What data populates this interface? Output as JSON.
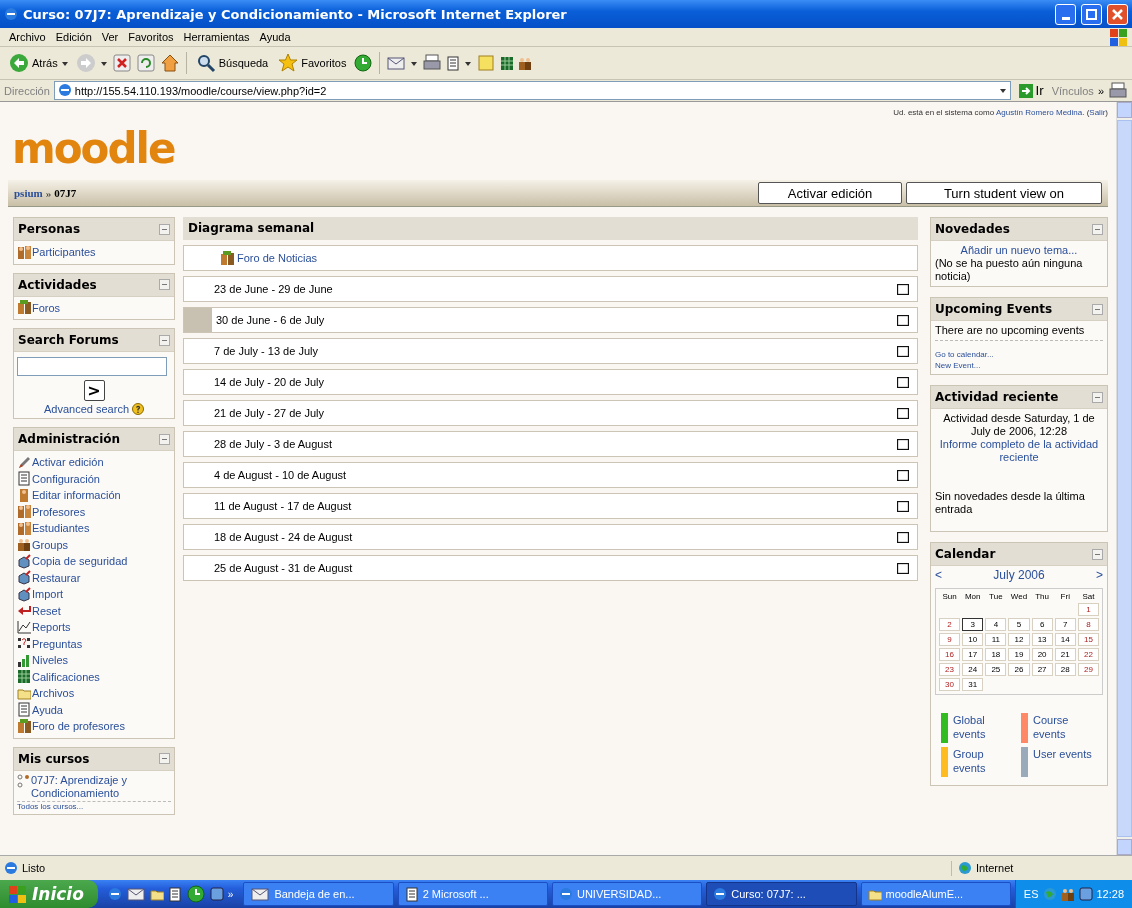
{
  "window": {
    "title": "Curso: 07J7: Aprendizaje y Condicionamiento - Microsoft Internet Explorer"
  },
  "menu": [
    "Archivo",
    "Edición",
    "Ver",
    "Favoritos",
    "Herramientas",
    "Ayuda"
  ],
  "toolbar": {
    "back": "Atrás",
    "search": "Búsqueda",
    "favorites": "Favoritos"
  },
  "address": {
    "label": "Dirección",
    "url": "http://155.54.110.193/moodle/course/view.php?id=2",
    "go": "Ir",
    "links": "Vínculos",
    "more": "»"
  },
  "page": {
    "logo": "moodle",
    "login": {
      "prefix": "Ud. está en el sistema como ",
      "user": "Agustín Romero Medina",
      "middle": ". (",
      "logout": "Salir",
      "suffix": ")"
    },
    "breadcrumb": {
      "parent": "psium",
      "separator": "»",
      "current": "07J7"
    },
    "buttons": [
      "Activar edición",
      "Turn student view on"
    ],
    "left_blocks": [
      {
        "kind": "links",
        "title": "Personas",
        "items": [
          "Participantes"
        ]
      },
      {
        "kind": "links",
        "title": "Actividades",
        "items": [
          "Foros"
        ]
      },
      {
        "kind": "search",
        "title": "Search Forums",
        "button": ">",
        "link": "Advanced search"
      },
      {
        "kind": "links",
        "title": "Administración",
        "items": [
          "Activar edición",
          "Configuración",
          "Editar información",
          "Profesores",
          "Estudiantes",
          "Groups",
          "Copia de seguridad",
          "Restaurar",
          "Import",
          "Reset",
          "Reports",
          "Preguntas",
          "Niveles",
          "Calificaciones",
          "Archivos",
          "Ayuda",
          "Foro de profesores"
        ]
      },
      {
        "kind": "courses",
        "title": "Mis cursos",
        "items": [
          "07J7: Aprendizaje y Condicionamiento"
        ],
        "footer": "Todos los cursos..."
      }
    ],
    "center": {
      "title": "Diagrama semanal",
      "forum": "Foro de Noticias",
      "weeks": [
        {
          "label": "23 de June - 29 de June",
          "current": false
        },
        {
          "label": "30 de June - 6 de July",
          "current": true
        },
        {
          "label": "7 de July - 13 de July",
          "current": false
        },
        {
          "label": "14 de July - 20 de July",
          "current": false
        },
        {
          "label": "21 de July - 27 de July",
          "current": false
        },
        {
          "label": "28 de July - 3 de August",
          "current": false
        },
        {
          "label": "4 de August - 10 de August",
          "current": false
        },
        {
          "label": "11 de August - 17 de August",
          "current": false
        },
        {
          "label": "18 de August - 24 de August",
          "current": false
        },
        {
          "label": "25 de August - 31 de August",
          "current": false
        }
      ]
    },
    "right_blocks": [
      {
        "kind": "content",
        "title": "Novedades",
        "content": [
          {
            "kind": "center-link",
            "text": "Añadir un nuevo tema..."
          },
          {
            "kind": "text",
            "text": "(No se ha puesto aún ninguna noticia)"
          }
        ]
      },
      {
        "kind": "content",
        "title": "Upcoming Events",
        "content": [
          {
            "kind": "divided-text",
            "text": "There are no upcoming events"
          },
          {
            "kind": "small-link",
            "text": "Go to calendar..."
          },
          {
            "kind": "small-link",
            "text": "New Event..."
          }
        ]
      },
      {
        "kind": "content",
        "title": "Actividad reciente",
        "content": [
          {
            "kind": "center-text",
            "text": "Actividad desde Saturday, 1 de July de 2006, 12:28"
          },
          {
            "kind": "center-link",
            "text": "Informe completo de la actividad reciente"
          },
          {
            "kind": "spaced-text",
            "text": "Sin novedades desde la última entrada"
          }
        ]
      },
      {
        "kind": "calendar",
        "title": "Calendar",
        "prev": "<",
        "month": "July 2006",
        "next": ">",
        "weekdays": [
          "Sun",
          "Mon",
          "Tue",
          "Wed",
          "Thu",
          "Fri",
          "Sat"
        ],
        "weeks": [
          [
            {
              "kind": "blank"
            },
            {
              "kind": "blank"
            },
            {
              "kind": "blank"
            },
            {
              "kind": "blank"
            },
            {
              "kind": "blank"
            },
            {
              "kind": "blank"
            },
            {
              "day": "1",
              "weekend": true,
              "today": false
            }
          ],
          [
            {
              "day": "2",
              "weekend": true,
              "today": false
            },
            {
              "day": "3",
              "weekend": false,
              "today": true
            },
            {
              "day": "4",
              "weekend": false,
              "today": false
            },
            {
              "day": "5",
              "weekend": false,
              "today": false
            },
            {
              "day": "6",
              "weekend": false,
              "today": false
            },
            {
              "day": "7",
              "weekend": false,
              "today": false
            },
            {
              "day": "8",
              "weekend": true,
              "today": false
            }
          ],
          [
            {
              "day": "9",
              "weekend": true,
              "today": false
            },
            {
              "day": "10",
              "weekend": false,
              "today": false
            },
            {
              "day": "11",
              "weekend": false,
              "today": false
            },
            {
              "day": "12",
              "weekend": false,
              "today": false
            },
            {
              "day": "13",
              "weekend": false,
              "today": false
            },
            {
              "day": "14",
              "weekend": false,
              "today": false
            },
            {
              "day": "15",
              "weekend": true,
              "today": false
            }
          ],
          [
            {
              "day": "16",
              "weekend": true,
              "today": false
            },
            {
              "day": "17",
              "weekend": false,
              "today": false
            },
            {
              "day": "18",
              "weekend": false,
              "today": false
            },
            {
              "day": "19",
              "weekend": false,
              "today": false
            },
            {
              "day": "20",
              "weekend": false,
              "today": false
            },
            {
              "day": "21",
              "weekend": false,
              "today": false
            },
            {
              "day": "22",
              "weekend": true,
              "today": false
            }
          ],
          [
            {
              "day": "23",
              "weekend": true,
              "today": false
            },
            {
              "day": "24",
              "weekend": false,
              "today": false
            },
            {
              "day": "25",
              "weekend": false,
              "today": false
            },
            {
              "day": "26",
              "weekend": false,
              "today": false
            },
            {
              "day": "27",
              "weekend": false,
              "today": false
            },
            {
              "day": "28",
              "weekend": false,
              "today": false
            },
            {
              "day": "29",
              "weekend": true,
              "today": false
            }
          ],
          [
            {
              "day": "30",
              "weekend": true,
              "today": false
            },
            {
              "day": "31",
              "weekend": false,
              "today": false
            },
            {
              "kind": "blank"
            },
            {
              "kind": "blank"
            },
            {
              "kind": "blank"
            },
            {
              "kind": "blank"
            },
            {
              "kind": "blank"
            }
          ]
        ],
        "legend": [
          {
            "label": "Global events",
            "color": "#33bb22"
          },
          {
            "label": "Course events",
            "color": "#ff8866"
          },
          {
            "label": "Group events",
            "color": "#ffbb22"
          },
          {
            "label": "User events",
            "color": "#99aabb"
          }
        ]
      }
    ]
  },
  "status_bar": {
    "text": "Listo",
    "zone": "Internet"
  },
  "taskbar": {
    "start": "Inicio",
    "more": "»",
    "tasks": [
      {
        "label": "Bandeja de en...",
        "selected": false
      },
      {
        "label": "2 Microsoft ...",
        "selected": false
      },
      {
        "label": "UNIVERSIDAD...",
        "selected": false
      },
      {
        "label": "Curso: 07J7: ...",
        "selected": true
      },
      {
        "label": "moodleAlumE...",
        "selected": false
      }
    ],
    "language": "ES",
    "clock": "12:28"
  }
}
